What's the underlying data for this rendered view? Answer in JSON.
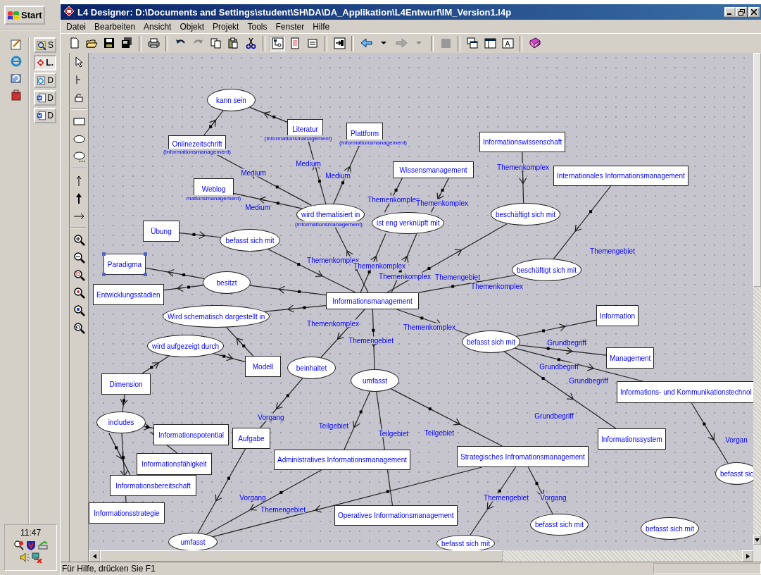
{
  "taskbar": {
    "start": "Start",
    "tasks": [
      {
        "label": "S",
        "selected": false
      },
      {
        "label": "L.",
        "selected": true
      },
      {
        "label": "D",
        "selected": false
      },
      {
        "label": "D",
        "selected": false
      },
      {
        "label": "D",
        "selected": false
      }
    ],
    "clock": "11:47"
  },
  "window": {
    "title": "L4 Designer: D:\\Documents and Settings\\student\\SH\\DA\\DA_Applikation\\L4Entwurf\\IM_Version1.l4p"
  },
  "menu": [
    "Datei",
    "Bearbeiten",
    "Ansicht",
    "Objekt",
    "Projekt",
    "Tools",
    "Fenster",
    "Hilfe"
  ],
  "diagram": {
    "nodes": [
      {
        "kind": "entity",
        "label": "Onlinezeitschrift",
        "subtitle": "(Informationsmanagement)",
        "selected": false
      },
      {
        "kind": "entity",
        "label": "Literatur",
        "subtitle": "(Informationsmanagement)",
        "selected": false
      },
      {
        "kind": "entity",
        "label": "Plattform",
        "subtitle": "(Informationsmanagement)",
        "selected": false
      },
      {
        "kind": "entity",
        "label": "Weblog",
        "subtitle": "mationsmanagement)",
        "selected": false
      },
      {
        "kind": "entity",
        "label": "Wissensmanagement",
        "selected": false
      },
      {
        "kind": "entity",
        "label": "Informationswissenschaft",
        "selected": false
      },
      {
        "kind": "entity",
        "label": "Internationales Informationsmanagement",
        "selected": false
      },
      {
        "kind": "entity",
        "label": "Übung",
        "selected": false
      },
      {
        "kind": "entity",
        "label": "Paradigma",
        "selected": true
      },
      {
        "kind": "entity",
        "label": "Entwicklungsstadien",
        "selected": false
      },
      {
        "kind": "entity",
        "label": "Informationsmanagement",
        "selected": false
      },
      {
        "kind": "entity",
        "label": "Information",
        "selected": false
      },
      {
        "kind": "entity",
        "label": "Modell",
        "selected": false
      },
      {
        "kind": "entity",
        "label": "Dimension",
        "selected": false
      },
      {
        "kind": "entity",
        "label": "Management",
        "selected": false
      },
      {
        "kind": "entity",
        "label": "Informations- und Kommunikationstechnol",
        "selected": false
      },
      {
        "kind": "entity",
        "label": "Informationspotential",
        "selected": false
      },
      {
        "kind": "entity",
        "label": "Aufgabe",
        "selected": false
      },
      {
        "kind": "entity",
        "label": "Informationssystem",
        "selected": false
      },
      {
        "kind": "entity",
        "label": "Administratives Informationsmanagement",
        "selected": false
      },
      {
        "kind": "entity",
        "label": "Strategisches Infromationsmanagement",
        "selected": false
      },
      {
        "kind": "entity",
        "label": "Informationsfähigkeit",
        "selected": false
      },
      {
        "kind": "entity",
        "label": "Informationsbereitschaft",
        "selected": false
      },
      {
        "kind": "entity",
        "label": "Informationsstrategie",
        "selected": false
      },
      {
        "kind": "entity",
        "label": "Operatives Informationsmanagement",
        "selected": false
      },
      {
        "kind": "relation",
        "label": "kann sein",
        "selected": false
      },
      {
        "kind": "relation",
        "label": "wird thematisiert in",
        "subtitle": "(Informationsmanagement)",
        "selected": false
      },
      {
        "kind": "relation",
        "label": "ist eng verknüpft mit",
        "selected": false
      },
      {
        "kind": "relation",
        "label": "beschäftigt sich mit",
        "selected": false
      },
      {
        "kind": "relation",
        "label": "befasst sich mit",
        "selected": false
      },
      {
        "kind": "relation",
        "label": "beschäftigt sich mit",
        "selected": false
      },
      {
        "kind": "relation",
        "label": "besitzt",
        "selected": false
      },
      {
        "kind": "relation",
        "label": "Wird schematisch dargestellt in",
        "selected": false
      },
      {
        "kind": "relation",
        "label": "wird aufgezeigt durch",
        "selected": false
      },
      {
        "kind": "relation",
        "label": "beinhaltet",
        "selected": false
      },
      {
        "kind": "relation",
        "label": "umfasst",
        "selected": false
      },
      {
        "kind": "relation",
        "label": "befasst sich mit",
        "selected": false
      },
      {
        "kind": "relation",
        "label": "includes",
        "selected": false
      },
      {
        "kind": "relation",
        "label": "befasst sic",
        "selected": false
      },
      {
        "kind": "relation",
        "label": "befasst sich mit",
        "selected": false
      },
      {
        "kind": "relation",
        "label": "befasst sich mit",
        "selected": false
      },
      {
        "kind": "relation",
        "label": "umfasst",
        "selected": false
      },
      {
        "kind": "relation",
        "label": "befasst sich mit",
        "selected": false
      }
    ],
    "connector_labels": [
      "Medium",
      "Medium",
      "Medium",
      "Medium",
      "Themenkomplex",
      "Themenkomplex",
      "Themenkomplex",
      "Themengebiet",
      "Themenkomplex",
      "Themenkomplex",
      "Themenkomplex",
      "Themengebiet",
      "Themenkomplex",
      "Themenkomplex",
      "Themengebiet",
      "Themenkomplex",
      "Grundbegriff",
      "Grundbegriff",
      "Grundbegriff",
      "Grundbegriff",
      "Vorgang",
      "Teilgebiet",
      "Teilgebiet",
      "Teilgebiet",
      "Vorgan",
      "Vorgang",
      "Themengebiet",
      "Themengebiet",
      "Vorgang"
    ]
  },
  "status_bar": "Für Hilfe, drücken Sie F1"
}
